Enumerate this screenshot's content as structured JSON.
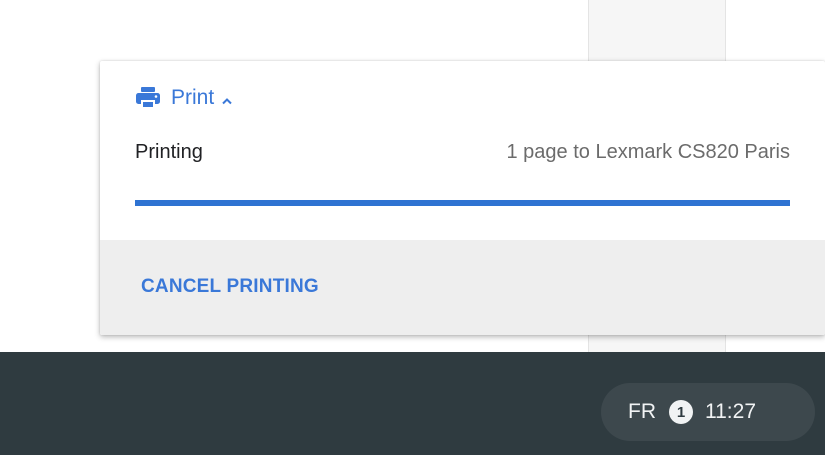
{
  "notification": {
    "source": "Print",
    "title": "Printing",
    "message": "1 page to Lexmark CS820 Paris",
    "progress_fraction": 1.0,
    "action_label": "CANCEL PRINTING",
    "accent_color": "#3a78d8"
  },
  "shelf": {
    "ime": "FR",
    "notification_count": "1",
    "time": "11:27",
    "background_color": "#2f3b40"
  },
  "icons": {
    "app": "printer-icon",
    "expand": "chevron-up-icon"
  }
}
